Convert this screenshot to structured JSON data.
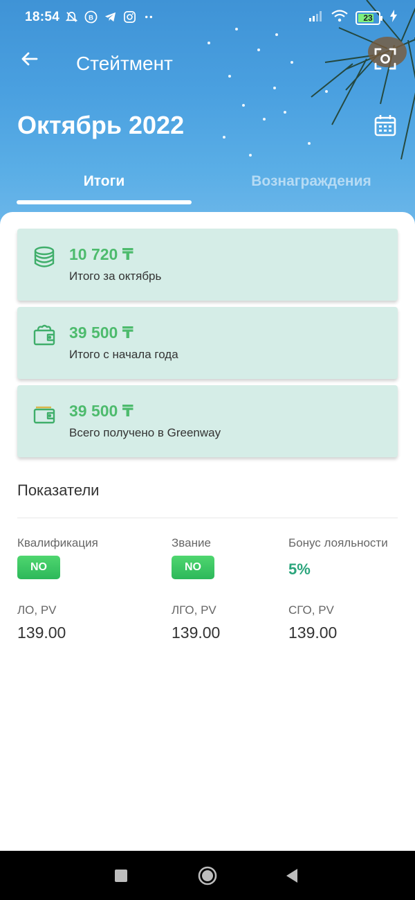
{
  "status_bar": {
    "time": "18:54",
    "battery": "23",
    "icons": [
      "muted-notifications-icon",
      "vk-icon",
      "telegram-icon",
      "instagram-icon",
      "more-icon",
      "signal-icon",
      "wifi-icon",
      "battery-icon",
      "charging-icon"
    ]
  },
  "header": {
    "title": "Стейтмент",
    "period": "Октябрь 2022"
  },
  "tabs": [
    {
      "label": "Итоги",
      "active": true
    },
    {
      "label": "Вознаграждения",
      "active": false
    }
  ],
  "cards": [
    {
      "amount": "10 720 ₸",
      "label": "Итого за октябрь",
      "icon": "coins-stack-icon"
    },
    {
      "amount": "39 500 ₸",
      "label": "Итого с начала года",
      "icon": "wallet-icon"
    },
    {
      "amount": "39 500 ₸",
      "label": "Всего получено в Greenway",
      "icon": "wallet-cards-icon"
    }
  ],
  "indicators": {
    "title": "Показатели",
    "qualification": {
      "label": "Квалификация",
      "value": "NO"
    },
    "rank": {
      "label": "Звание",
      "value": "NO"
    },
    "loyalty": {
      "label": "Бонус лояльности",
      "value": "5%"
    },
    "lo": {
      "label": "ЛО, PV",
      "value": "139.00"
    },
    "lgo": {
      "label": "ЛГО, PV",
      "value": "139.00"
    },
    "sgo": {
      "label": "СГО, PV",
      "value": "139.00"
    }
  },
  "colors": {
    "accent_green": "#4dbb6d",
    "card_bg": "#d5ede7",
    "header_blue": "#4aa0e0"
  }
}
